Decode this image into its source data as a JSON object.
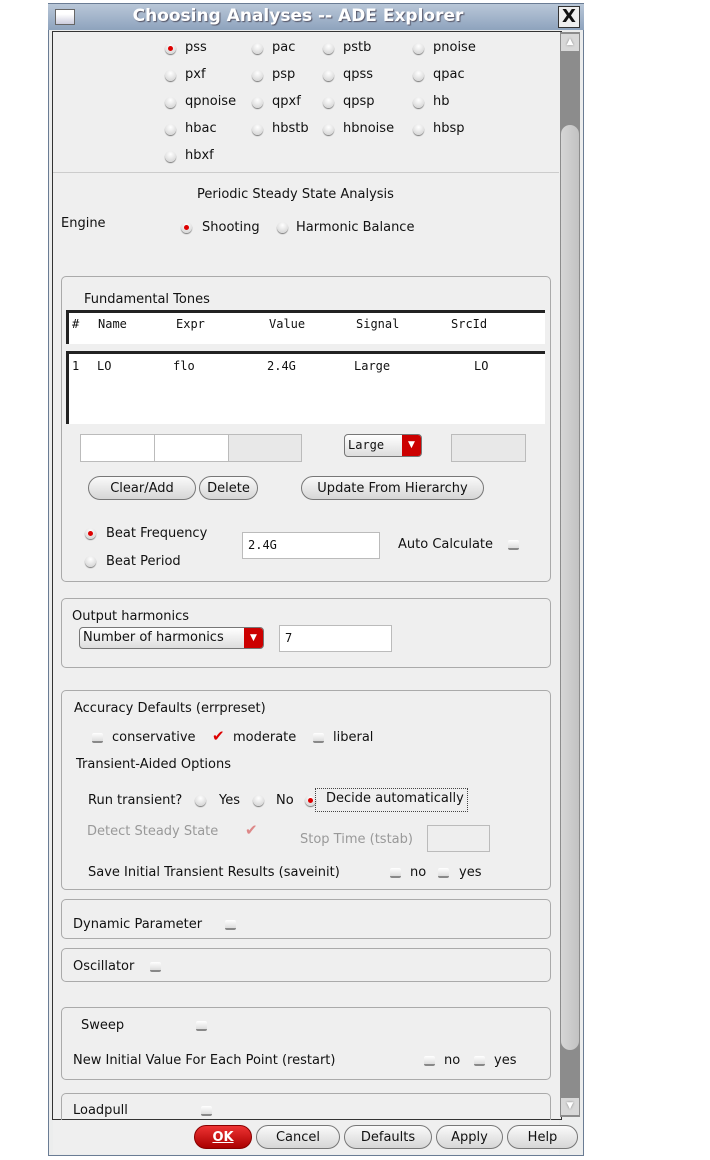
{
  "window": {
    "title": "Choosing Analyses -- ADE Explorer",
    "close": "X"
  },
  "analyses": [
    {
      "label": "pss",
      "selected": true
    },
    {
      "label": "pac"
    },
    {
      "label": "pstb"
    },
    {
      "label": "pnoise"
    },
    {
      "label": "pxf"
    },
    {
      "label": "psp"
    },
    {
      "label": "qpss"
    },
    {
      "label": "qpac"
    },
    {
      "label": "qpnoise"
    },
    {
      "label": "qpxf"
    },
    {
      "label": "qpsp"
    },
    {
      "label": "hb"
    },
    {
      "label": "hbac"
    },
    {
      "label": "hbstb"
    },
    {
      "label": "hbnoise"
    },
    {
      "label": "hbsp"
    },
    {
      "label": "hbxf"
    }
  ],
  "section_title": "Periodic Steady State Analysis",
  "engine": {
    "label": "Engine",
    "options": [
      "Shooting",
      "Harmonic Balance"
    ],
    "selected": "Shooting"
  },
  "tones": {
    "label": "Fundamental Tones",
    "headers": [
      "#",
      "Name",
      "Expr",
      "Value",
      "Signal",
      "SrcId"
    ],
    "rows": [
      [
        "1",
        "LO",
        "flo",
        "2.4G",
        "Large",
        "LO"
      ]
    ],
    "signal_select": "Large",
    "buttons": [
      "Clear/Add",
      "Delete",
      "Update From Hierarchy"
    ]
  },
  "beat": {
    "freq_label": "Beat Frequency",
    "period_label": "Beat Period",
    "value": "2.4G",
    "auto_label": "Auto Calculate"
  },
  "harmonics": {
    "label": "Output harmonics",
    "select": "Number of harmonics",
    "value": "7"
  },
  "accuracy": {
    "label": "Accuracy Defaults (errpreset)",
    "options": [
      "conservative",
      "moderate",
      "liberal"
    ],
    "selected": "moderate"
  },
  "transient": {
    "label": "Transient-Aided Options",
    "run_label": "Run transient?",
    "options": [
      "Yes",
      "No",
      "Decide automatically"
    ],
    "selected": "Decide automatically",
    "detect_label": "Detect Steady State",
    "stop_label": "Stop Time (tstab)",
    "saveinit_label": "Save Initial Transient Results (saveinit)",
    "no": "no",
    "yes": "yes"
  },
  "dynamic": {
    "label": "Dynamic Parameter"
  },
  "oscillator": {
    "label": "Oscillator"
  },
  "sweep": {
    "label": "Sweep",
    "restart_label": "New Initial Value For Each Point (restart)",
    "no": "no",
    "yes": "yes"
  },
  "loadpull": {
    "label": "Loadpull"
  },
  "footer": {
    "ok": "OK",
    "cancel": "Cancel",
    "defaults": "Defaults",
    "apply": "Apply",
    "help": "Help"
  },
  "colors": {
    "accent": "#cc0000",
    "titlebar": "#9fb2c9"
  }
}
